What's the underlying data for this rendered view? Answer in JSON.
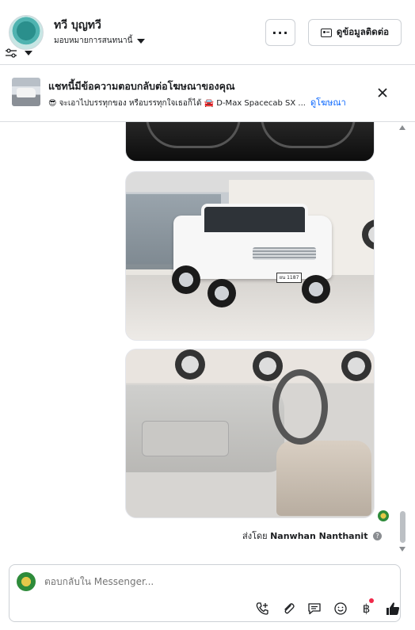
{
  "header": {
    "user_name": "ทวี บุญทวี",
    "assign_label": "มอบหมายการสนทนานี้",
    "more_label": "···",
    "contact_label": "ดูข้อมูลติดต่อ"
  },
  "ad": {
    "title": "แชทนี้มีข้อความตอบกลับต่อโฆษณาของคุณ",
    "description": "😎 จะเอาไปบรรทุกของ หรือบรรทุกใจเธอก็ได้ 🚘 D-Max Spacecab SX ...",
    "link": "ดูโฆษณา"
  },
  "chat": {
    "plate_text": "ยน 1187",
    "sent_by_prefix": "ส่งโดย",
    "sent_by_name": "Nanwhan Nanthanit",
    "help": "?"
  },
  "composer": {
    "placeholder": "ตอบกลับใน Messenger...",
    "currency_symbol": "฿"
  }
}
